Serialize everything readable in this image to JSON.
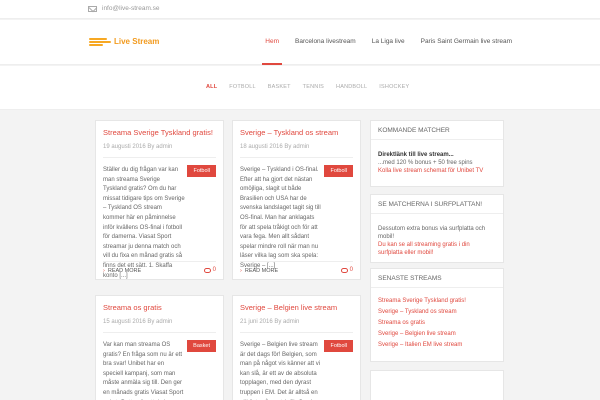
{
  "topbar": {
    "email": "info@live-stream.se"
  },
  "header": {
    "logo_text": "Live Stream",
    "nav": [
      "Hem",
      "Barcelona livestream",
      "La Liga live",
      "Paris Saint Germain live stream"
    ]
  },
  "filters": [
    "ALL",
    "FOTBOLL",
    "BASKET",
    "TENNIS",
    "HANDBOLL",
    "ISHOCKEY"
  ],
  "posts": [
    {
      "title": "Streama Sverige Tyskland gratis!",
      "meta": "19 augusti 2016 By admin",
      "category": "Fotboll",
      "excerpt": "Ställer du dig frågan var kan man streama Sverige Tyskland gratis? Om du har missat tidigare tips om Sverige – Tyskland OS stream kommer här en påminnelse inför kvällens OS-final i fotboll för damerna. Viasat Sport streamar ju denna match och vill du fixa en månad gratis så finns det ett sätt. 1. Skaffa konto [...]",
      "read_more": "READ MORE",
      "comments": "0"
    },
    {
      "title": "Sverige – Tyskland os stream",
      "meta": "18 augusti 2016 By admin",
      "category": "Fotboll",
      "excerpt": "Sverige – Tyskland i OS-final. Efter att ha gjort det nästan omöjliga, slagit ut både Brasilien och USA har de svenska landslaget tagit sig till OS-final. Man har anklagats för att spela tråkigt och för att vara fega. Men allt sådant spelar mindre roll när man nu läser vilka lag som ska spela: Sverige – [...]",
      "read_more": "READ MORE",
      "comments": "0"
    },
    {
      "title": "Streama os gratis",
      "meta": "15 augusti 2016 By admin",
      "category": "Basket",
      "excerpt": "Var kan man streama OS gratis? En fråga som nu är ett bra svar! Unibet har en speciell kampanj, som man måste anmäla sig till. Den ger en månads gratis Viasat Sport paket. Detta gör att du kan",
      "read_more": "",
      "comments": ""
    },
    {
      "title": "Sverige – Belgien live stream",
      "meta": "21 juni 2016 By admin",
      "category": "Fotboll",
      "excerpt": "Sverige – Belgien live stream är det dags för! Belgien, som man på något vis känner att vi kan slå, är ett av de absoluta topplagen, med den dyrast truppen i EM. Det är alltså en väldigt svår match för Sverige. Och,",
      "read_more": "",
      "comments": ""
    }
  ],
  "sidebar": {
    "kommande": {
      "title": "KOMMANDE MATCHER",
      "line1": "Direktlänk till live stream...",
      "line2": "...med 120 % bonus + 50 free spins",
      "line3": "Kolla live stream schemat för Unibet TV"
    },
    "surf": {
      "title": "SE MATCHERNA I SURFPLATTAN!",
      "text": "Dessutom extra bonus via surfplatta och mobil!",
      "link": "Du kan se all streaming gratis i din surfplatta eller mobil!"
    },
    "senaste": {
      "title": "SENASTE STREAMS",
      "items": [
        "Streama Sverige Tyskland gratis!",
        "Sverige – Tyskland os stream",
        "Streama os gratis",
        "Sverige – Belgien live stream",
        "Sverige – Italien EM live stream"
      ]
    }
  },
  "colors": {
    "accent": "#e0483e",
    "logo": "#f29a1d",
    "background": "#f3f3f3"
  }
}
